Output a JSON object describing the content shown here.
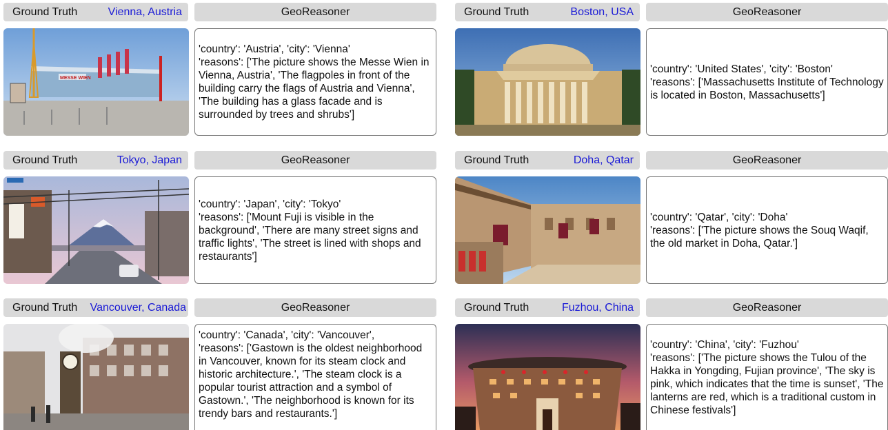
{
  "labels": {
    "ground_truth": "Ground Truth",
    "geo_reasoner": "GeoReasoner"
  },
  "colors": {
    "bar_bg": "#d9d9d9",
    "location_text": "#1a1ad6",
    "box_border": "#777777"
  },
  "examples": [
    {
      "location": "Vienna, Austria",
      "photo_icon": "messe-wien-building-photo",
      "sign_text": "MESSE WIEN",
      "country_line": "'country': 'Austria', 'city': 'Vienna'",
      "reasons_line": "'reasons': ['The picture shows the Messe Wien in Vienna, Austria', 'The flagpoles in front of the building carry the flags of Austria and Vienna', 'The building has a glass facade and is surrounded by trees and shrubs']"
    },
    {
      "location": "Boston, USA",
      "photo_icon": "mit-great-dome-photo",
      "country_line": "'country': 'United States', 'city': 'Boston'",
      "reasons_line": "'reasons': ['Massachusetts Institute of Technology is located in Boston, Massachusetts']"
    },
    {
      "location": "Tokyo, Japan",
      "photo_icon": "tokyo-street-mount-fuji-photo",
      "country_line": "'country': 'Japan', 'city': 'Tokyo'",
      "reasons_line": "'reasons': ['Mount Fuji is visible in the background', 'There are many street signs and traffic lights', 'The street is lined with shops and restaurants']"
    },
    {
      "location": "Doha, Qatar",
      "photo_icon": "souq-waqif-market-photo",
      "country_line": "'country': 'Qatar', 'city': 'Doha'",
      "reasons_line": "'reasons': ['The picture shows the Souq Waqif, the old market in Doha, Qatar.']"
    },
    {
      "location": "Vancouver, Canada",
      "photo_icon": "gastown-steam-clock-photo",
      "country_line": "'country': 'Canada', 'city': 'Vancouver',",
      "reasons_line": "'reasons': ['Gastown is the oldest neighborhood in Vancouver, known for its steam clock and historic architecture.', 'The steam clock is a popular tourist attraction and a symbol of Gastown.', 'The neighborhood is known for its trendy bars and restaurants.']"
    },
    {
      "location": "Fuzhou, China",
      "photo_icon": "hakka-tulou-sunset-photo",
      "country_line": "'country': 'China', 'city': 'Fuzhou'",
      "reasons_line": "'reasons': ['The picture shows the Tulou of the Hakka in Yongding, Fujian province', 'The sky is pink, which indicates that the time is sunset', 'The lanterns are red, which is a traditional custom in Chinese festivals']"
    }
  ]
}
